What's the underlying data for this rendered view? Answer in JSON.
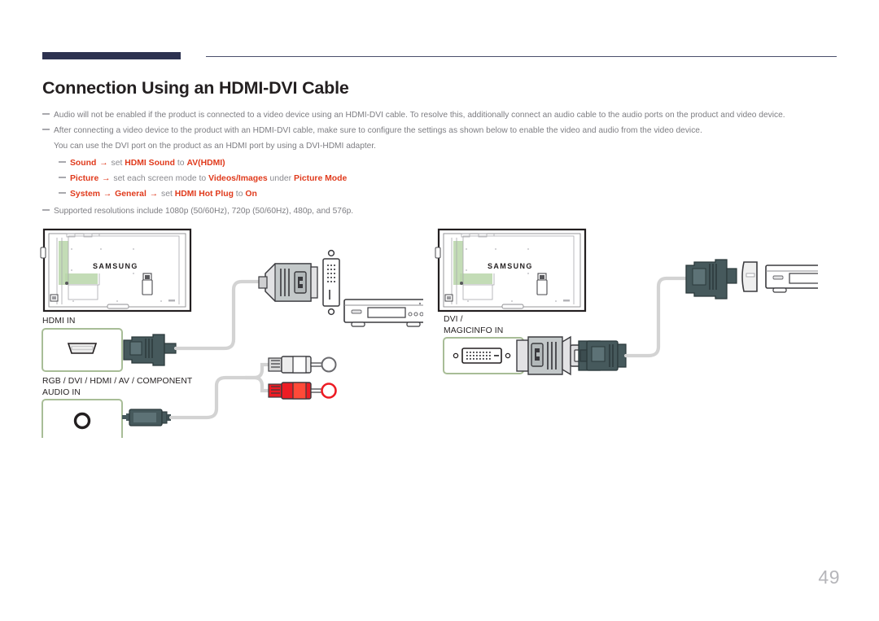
{
  "document": {
    "page_number": "49",
    "title": "Connection Using an HDMI-DVI Cable",
    "accent_color": "#2d3250",
    "highlight_color": "#e03a1c",
    "port_box_color": "#a8bd97"
  },
  "notes": [
    {
      "id": "note-audio",
      "text": "Audio will not be enabled if the product is connected to a video device using an HDMI-DVI cable. To resolve this, additionally connect an audio cable to the audio ports on the product and video device."
    },
    {
      "id": "note-settings",
      "text": "After connecting a video device to the product with an HDMI-DVI cable, make sure to configure the settings as shown below to enable the video and audio from the video device.",
      "continuation": "You can use the DVI port on the product as an HDMI port by using a DVI-HDMI adapter."
    }
  ],
  "settings_steps": [
    {
      "id": "step-sound",
      "parts": [
        {
          "text": "Sound",
          "style": "hl"
        },
        {
          "text": " → ",
          "style": "arrow"
        },
        {
          "text": "set ",
          "style": "plain"
        },
        {
          "text": "HDMI Sound",
          "style": "hl"
        },
        {
          "text": " to ",
          "style": "plain"
        },
        {
          "text": "AV(HDMI)",
          "style": "hl"
        }
      ]
    },
    {
      "id": "step-picture",
      "parts": [
        {
          "text": "Picture",
          "style": "hl"
        },
        {
          "text": " → ",
          "style": "arrow"
        },
        {
          "text": "set each screen mode to ",
          "style": "plain"
        },
        {
          "text": "Videos/Images",
          "style": "hl"
        },
        {
          "text": " under ",
          "style": "plain"
        },
        {
          "text": "Picture Mode",
          "style": "hl"
        }
      ]
    },
    {
      "id": "step-system",
      "parts": [
        {
          "text": "System",
          "style": "hl"
        },
        {
          "text": " → ",
          "style": "arrow"
        },
        {
          "text": "General",
          "style": "hl"
        },
        {
          "text": " → ",
          "style": "arrow"
        },
        {
          "text": "set ",
          "style": "plain"
        },
        {
          "text": "HDMI Hot Plug",
          "style": "hl"
        },
        {
          "text": " to ",
          "style": "plain"
        },
        {
          "text": "On",
          "style": "hl"
        }
      ]
    }
  ],
  "note_resolutions": {
    "id": "note-resolutions",
    "text": "Supported resolutions include 1080p (50/60Hz), 720p (50/60Hz), 480p, and 576p."
  },
  "diagrams": {
    "left": {
      "id": "diagram-hdmi-to-dvi",
      "monitor_brand": "SAMSUNG",
      "ports": [
        {
          "id": "port-hdmi-in",
          "label": "HDMI IN",
          "connector": "hdmi-plug"
        },
        {
          "id": "port-audio-in",
          "label": "RGB / DVI / HDMI / AV / COMPONENT\nAUDIO IN",
          "connector": "stereo-jack"
        }
      ],
      "cable_ends": [
        {
          "id": "dvi-adapter",
          "type": "dvi-connector"
        },
        {
          "id": "dvi-port-device",
          "type": "dvi-female-port"
        },
        {
          "id": "rca-white",
          "type": "rca-plug",
          "color": "#d7d7d7"
        },
        {
          "id": "rca-red",
          "type": "rca-plug",
          "color": "#ed1c24"
        }
      ],
      "device": {
        "id": "av-device-left",
        "type": "media-player"
      }
    },
    "right": {
      "id": "diagram-dvi-to-hdmi",
      "monitor_brand": "SAMSUNG",
      "ports": [
        {
          "id": "port-dvi-magicinfo-in",
          "label": "DVI /\nMAGICINFO IN",
          "connector": "dvi-plug"
        }
      ],
      "cable_ends": [
        {
          "id": "hdmi-plug-right",
          "type": "hdmi-connector"
        },
        {
          "id": "hdmi-port-device",
          "type": "hdmi-female-port"
        }
      ],
      "device": {
        "id": "av-device-right",
        "type": "media-player"
      }
    }
  }
}
